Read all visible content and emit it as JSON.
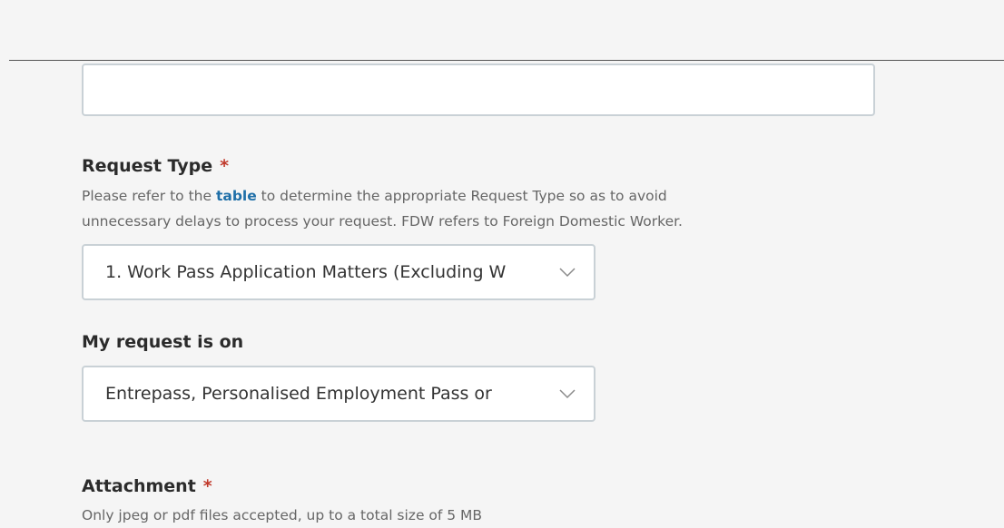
{
  "form": {
    "text_field_value": "",
    "request_type": {
      "label": "Request Type",
      "required_mark": "*",
      "hint_before_link": "Please refer to the ",
      "hint_link": "table",
      "hint_after_link": " to determine the appropriate Request Type so as to avoid",
      "hint_line2": "unnecessary delays to process your request. FDW refers to Foreign Domestic Worker.",
      "selected": "1. Work Pass Application Matters (Excluding W"
    },
    "request_on": {
      "label": "My request is on",
      "selected": "Entrepass, Personalised Employment Pass or"
    },
    "attachment": {
      "label": "Attachment",
      "required_mark": "*",
      "hint": "Only jpeg or pdf files accepted, up to a total size of 5 MB"
    }
  },
  "icons": {
    "chevron": "chevron-down-icon"
  },
  "colors": {
    "background": "#f5f5f5",
    "border": "#c9d1d6",
    "required": "#c0392b",
    "link": "#1f6fa8"
  }
}
